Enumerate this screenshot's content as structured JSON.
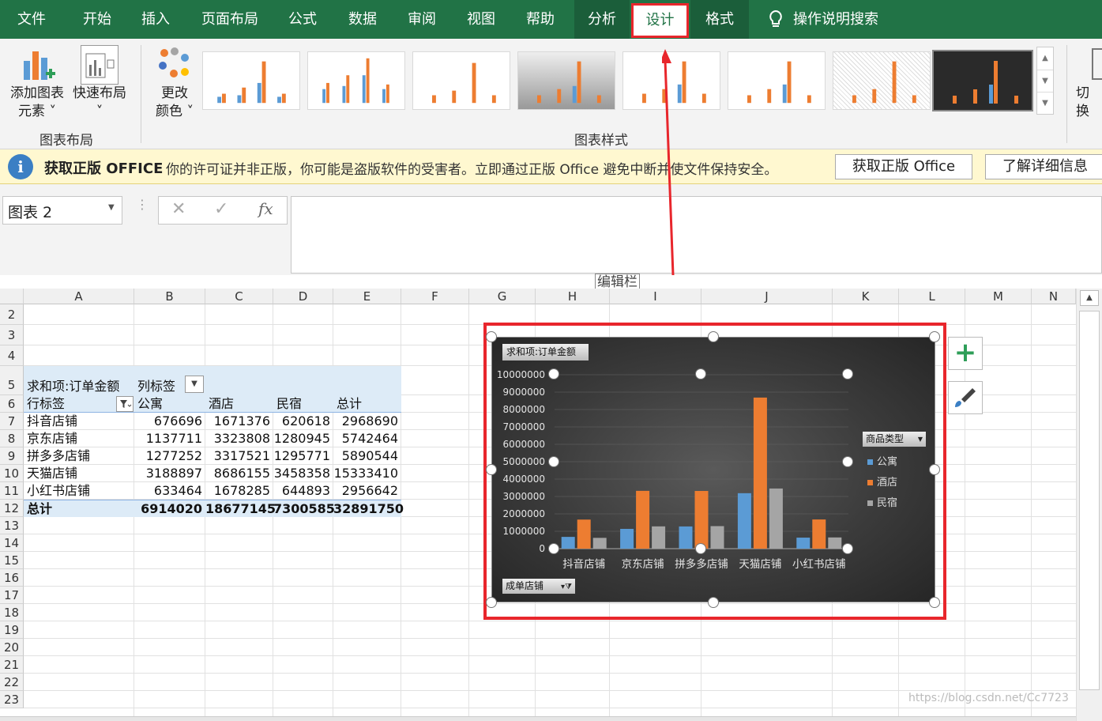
{
  "tabs": [
    "文件",
    "开始",
    "插入",
    "页面布局",
    "公式",
    "数据",
    "审阅",
    "视图",
    "帮助",
    "分析",
    "设计",
    "格式"
  ],
  "tell_me": "操作说明搜索",
  "ribbon": {
    "add_element": [
      "添加图表",
      "元素 ˅"
    ],
    "quick_layout": [
      "快速布局",
      "˅"
    ],
    "change_color": [
      "更改",
      "颜色 ˅"
    ],
    "group_layout": "图表布局",
    "group_styles": "图表样式",
    "switch": "切换"
  },
  "message": {
    "title": "获取正版 OFFICE",
    "text": "你的许可证并非正版，你可能是盗版软件的受害者。立即通过正版 Office 避免中断并使文件保持安全。",
    "btn1": "获取正版 Office",
    "btn2": "了解详细信息"
  },
  "namebox": "图表 2",
  "annotation": "编辑栏",
  "columns": [
    "A",
    "B",
    "C",
    "D",
    "E",
    "F",
    "G",
    "H",
    "I",
    "J",
    "K",
    "L",
    "M",
    "N"
  ],
  "rows": [
    "2",
    "3",
    "4",
    "5",
    "6",
    "7",
    "8",
    "9",
    "10",
    "11",
    "12",
    "13",
    "14",
    "15",
    "16",
    "17",
    "18",
    "19",
    "20",
    "21",
    "22",
    "23"
  ],
  "pivot": {
    "title": "求和项:订单金额",
    "col_label": "列标签",
    "row_label": "行标签",
    "headers": [
      "公寓",
      "酒店",
      "民宿",
      "总计"
    ],
    "rows": [
      {
        "name": "抖音店铺",
        "vals": [
          "676696",
          "1671376",
          "620618",
          "2968690"
        ]
      },
      {
        "name": "京东店铺",
        "vals": [
          "1137711",
          "3323808",
          "1280945",
          "5742464"
        ]
      },
      {
        "name": "拼多多店铺",
        "vals": [
          "1277252",
          "3317521",
          "1295771",
          "5890544"
        ]
      },
      {
        "name": "天猫店铺",
        "vals": [
          "3188897",
          "8686155",
          "3458358",
          "15333410"
        ]
      },
      {
        "name": "小红书店铺",
        "vals": [
          "633464",
          "1678285",
          "644893",
          "2956642"
        ]
      }
    ],
    "total": {
      "name": "总计",
      "vals": [
        "6914020",
        "18677145",
        "7300585",
        "32891750"
      ]
    }
  },
  "chart_data": {
    "type": "bar",
    "field_title": "求和项:订单金额",
    "categories": [
      "抖音店铺",
      "京东店铺",
      "拼多多店铺",
      "天猫店铺",
      "小红书店铺"
    ],
    "series": [
      {
        "name": "公寓",
        "color": "#5b9bd5",
        "values": [
          676696,
          1137711,
          1277252,
          3188897,
          633464
        ]
      },
      {
        "name": "酒店",
        "color": "#ed7d31",
        "values": [
          1671376,
          3323808,
          3317521,
          8686155,
          1678285
        ]
      },
      {
        "name": "民宿",
        "color": "#a5a5a5",
        "values": [
          620618,
          1280945,
          1295771,
          3458358,
          644893
        ]
      }
    ],
    "yticks": [
      "10000000",
      "9000000",
      "8000000",
      "7000000",
      "6000000",
      "5000000",
      "4000000",
      "3000000",
      "2000000",
      "1000000",
      "0"
    ],
    "ylim": [
      0,
      10000000
    ],
    "legend_title": "商品类型",
    "legend_position": "right",
    "axis_field": "成单店铺"
  },
  "watermark": "https://blog.csdn.net/Cc7723"
}
